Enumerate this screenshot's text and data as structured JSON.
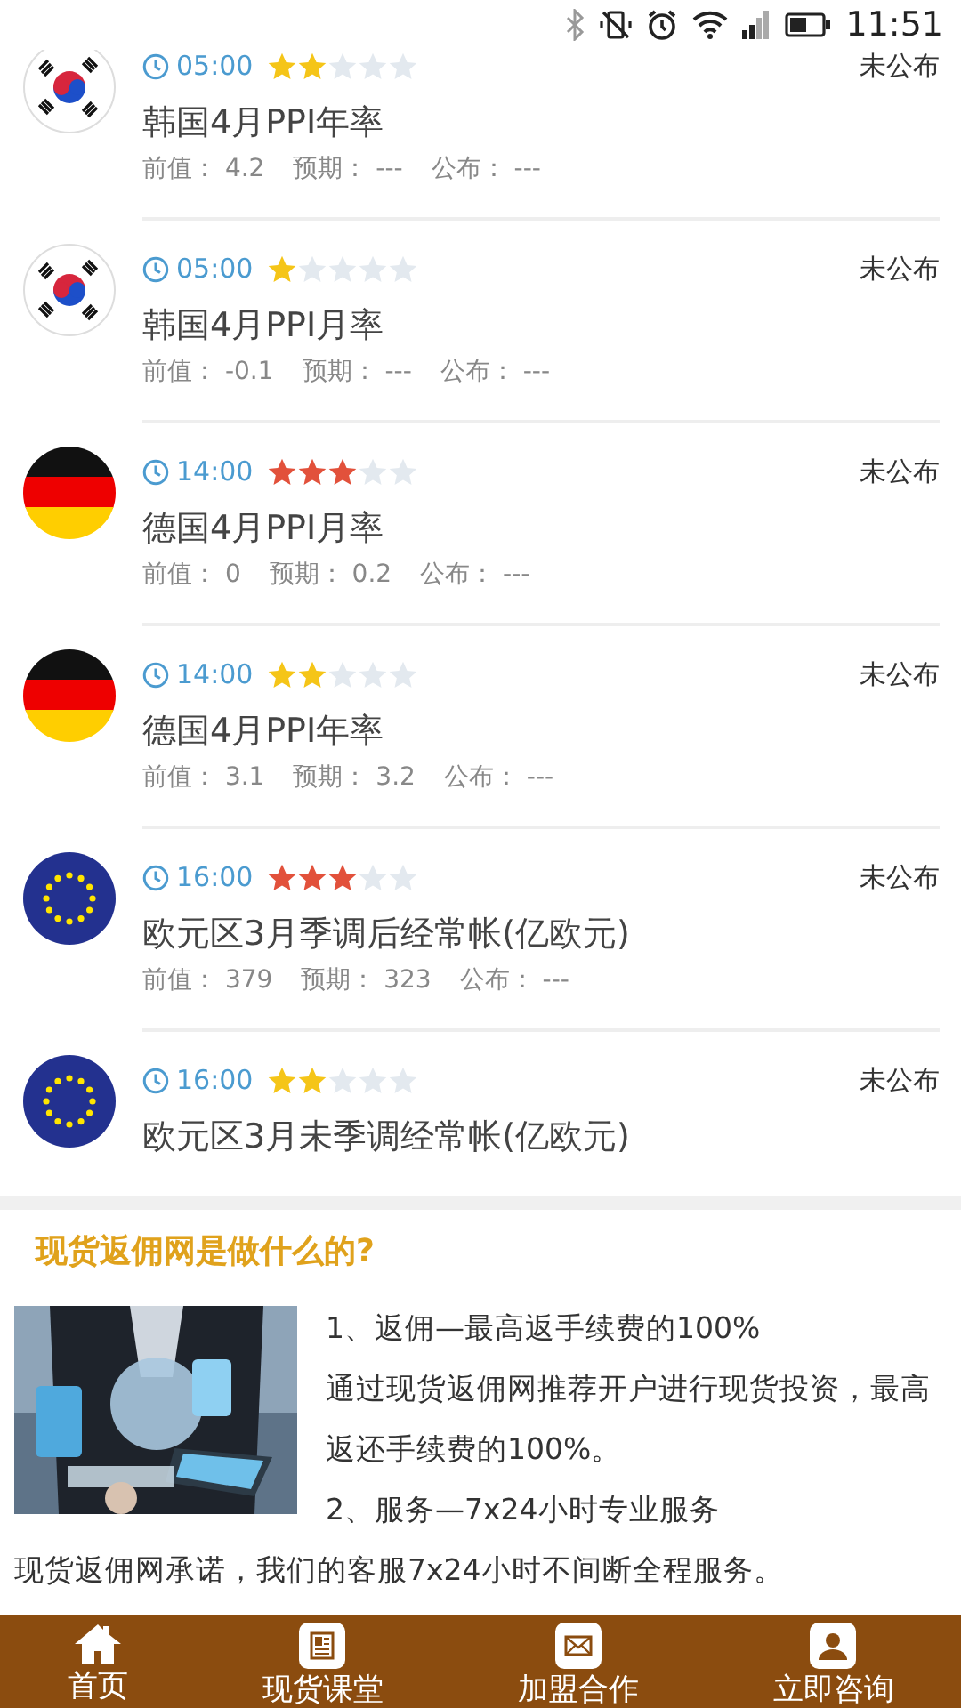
{
  "status_bar": {
    "time": "11:51"
  },
  "events": [
    {
      "kind": "korea",
      "time": "05:00",
      "stars": 2,
      "color": "#f5c518",
      "title": "韩国4月PPI年率",
      "status": "未公布",
      "details": [
        {
          "label": "前值：",
          "value": "4.2"
        },
        {
          "label": "预期：",
          "value": "---"
        },
        {
          "label": "公布：",
          "value": "---"
        }
      ]
    },
    {
      "kind": "korea",
      "time": "05:00",
      "stars": 1,
      "color": "#f5c518",
      "title": "韩国4月PPI月率",
      "status": "未公布",
      "details": [
        {
          "label": "前值：",
          "value": "-0.1"
        },
        {
          "label": "预期：",
          "value": "---"
        },
        {
          "label": "公布：",
          "value": "---"
        }
      ]
    },
    {
      "kind": "germany",
      "time": "14:00",
      "stars": 3,
      "color": "#e2513b",
      "title": "德国4月PPI月率",
      "status": "未公布",
      "details": [
        {
          "label": "前值：",
          "value": "0"
        },
        {
          "label": "预期：",
          "value": "0.2"
        },
        {
          "label": "公布：",
          "value": "---"
        }
      ]
    },
    {
      "kind": "germany",
      "time": "14:00",
      "stars": 2,
      "color": "#f5c518",
      "title": "德国4月PPI年率",
      "status": "未公布",
      "details": [
        {
          "label": "前值：",
          "value": "3.1"
        },
        {
          "label": "预期：",
          "value": "3.2"
        },
        {
          "label": "公布：",
          "value": "---"
        }
      ]
    },
    {
      "kind": "eu",
      "time": "16:00",
      "stars": 3,
      "color": "#e2513b",
      "title": "欧元区3月季调后经常帐(亿欧元)",
      "status": "未公布",
      "details": [
        {
          "label": "前值：",
          "value": "379"
        },
        {
          "label": "预期：",
          "value": "323"
        },
        {
          "label": "公布：",
          "value": "---"
        }
      ]
    },
    {
      "kind": "eu",
      "time": "16:00",
      "stars": 2,
      "color": "#f5c518",
      "title": "欧元区3月未季调经常帐(亿欧元)",
      "status": "未公布"
    }
  ],
  "about": {
    "title": "现货返佣网是做什么的?",
    "picture": {
      "kind": "picture"
    },
    "paragraphs": [
      "1、返佣—最高返手续费的100%",
      "通过现货返佣网推荐开户进行现货投资，最高返还手续费的100%。",
      "2、服务—7x24小时专业服务"
    ],
    "footer_text": "现货返佣网承诺，我们的客服7x24小时不间断全程服务。"
  },
  "nav": [
    {
      "kind": "home",
      "label": "首页"
    },
    {
      "kind": "news",
      "label": "现货课堂"
    },
    {
      "kind": "mail",
      "label": "加盟合作"
    },
    {
      "kind": "user",
      "label": "立即咨询"
    }
  ]
}
